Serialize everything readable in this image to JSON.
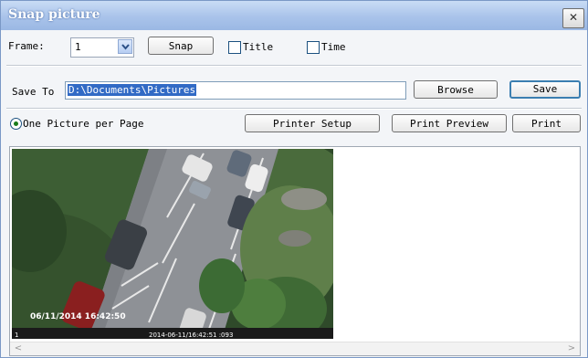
{
  "window": {
    "title": "Snap picture",
    "close_symbol": "✕"
  },
  "row1": {
    "frame_label": "Frame:",
    "frame_value": "1",
    "snap_label": "Snap",
    "title_checkbox_label": "Title",
    "title_checked": false,
    "time_checkbox_label": "Time",
    "time_checked": false
  },
  "row2": {
    "save_to_label": "Save To",
    "path_value": "D:\\Documents\\Pictures",
    "browse_label": "Browse",
    "save_label": "Save"
  },
  "row3": {
    "one_per_page_label": "One Picture per Page",
    "one_per_page_selected": true,
    "printer_setup_label": "Printer Setup",
    "print_preview_label": "Print Preview",
    "print_label": "Print"
  },
  "preview": {
    "osd_timestamp": "06/11/2014 16:42:50",
    "frame_number": "1",
    "capture_time": "2014-06-11/16:42:51 :093"
  },
  "colors": {
    "titlebar": "#a9c3ea",
    "selection": "#316ac5",
    "accent_focus": "#3c7fb1"
  }
}
